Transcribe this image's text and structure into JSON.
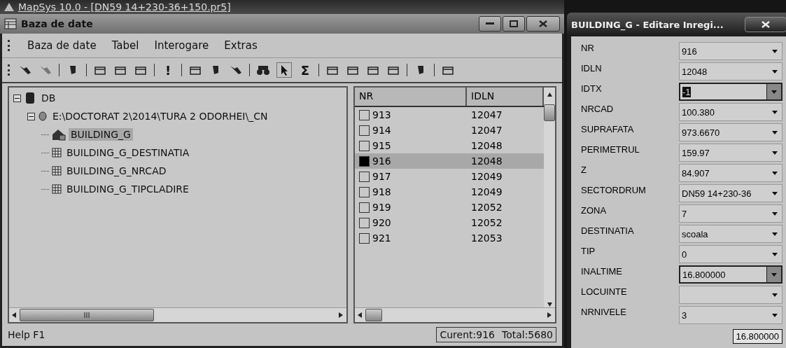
{
  "app_title": "MapSys 10.0 - [DN59 14+230-36+150.pr5]",
  "window": {
    "title": "Baza de date"
  },
  "menu": [
    {
      "label": "Baza de date"
    },
    {
      "label": "Tabel"
    },
    {
      "label": "Interogare"
    },
    {
      "label": "Extras"
    }
  ],
  "toolbar_glyphs": [
    "!",
    "Σ"
  ],
  "tree": [
    {
      "label": "DB",
      "kind": "database",
      "expanded": true,
      "selected": false,
      "children": [
        {
          "label": "E:\\DOCTORAT 2\\2014\\TURA 2 ODORHEI\\_CN",
          "kind": "file",
          "expanded": true,
          "selected": false,
          "children": [
            {
              "label": "BUILDING_G",
              "kind": "layer",
              "selected": true
            },
            {
              "label": "BUILDING_G_DESTINATIA",
              "kind": "table",
              "selected": false
            },
            {
              "label": "BUILDING_G_NRCAD",
              "kind": "table",
              "selected": false
            },
            {
              "label": "BUILDING_G_TIPCLADIRE",
              "kind": "table",
              "selected": false
            }
          ]
        }
      ]
    }
  ],
  "table": {
    "columns": [
      "NR",
      "IDLN"
    ],
    "rows": [
      {
        "cells": [
          "913",
          "12047"
        ],
        "selected": false
      },
      {
        "cells": [
          "914",
          "12047"
        ],
        "selected": false
      },
      {
        "cells": [
          "915",
          "12048"
        ],
        "selected": false
      },
      {
        "cells": [
          "916",
          "12048"
        ],
        "selected": true
      },
      {
        "cells": [
          "917",
          "12049"
        ],
        "selected": false
      },
      {
        "cells": [
          "918",
          "12049"
        ],
        "selected": false
      },
      {
        "cells": [
          "919",
          "12052"
        ],
        "selected": false
      },
      {
        "cells": [
          "920",
          "12052"
        ],
        "selected": false
      },
      {
        "cells": [
          "921",
          "12053"
        ],
        "selected": false
      }
    ]
  },
  "status_bar": {
    "help": "Help F1",
    "current": "Curent:916",
    "total": "Total:5680"
  },
  "dialog": {
    "title": "BUILDING_G - Editare Inregi...",
    "fields": [
      {
        "label": "NR",
        "value": "916",
        "active": false
      },
      {
        "label": "IDLN",
        "value": "12048",
        "active": false
      },
      {
        "label": "IDTX",
        "value": "-1",
        "active": true
      },
      {
        "label": "NRCAD",
        "value": "100.380",
        "active": false
      },
      {
        "label": "SUPRAFATA",
        "value": "973.6670",
        "active": false
      },
      {
        "label": "PERIMETRUL",
        "value": "159.97",
        "active": false
      },
      {
        "label": "Z",
        "value": "84.907",
        "active": false
      },
      {
        "label": "SECTORDRUM",
        "value": "DN59 14+230-36",
        "active": false
      },
      {
        "label": "ZONA",
        "value": "7",
        "active": false
      },
      {
        "label": "DESTINATIA",
        "value": "scoala",
        "active": false
      },
      {
        "label": "TIP",
        "value": "0",
        "active": false
      },
      {
        "label": "INALTIME",
        "value": "16.800000",
        "active": true
      },
      {
        "label": "LOCUINTE",
        "active": false
      },
      {
        "label": "NRNIVELE",
        "value": "3",
        "active": false
      }
    ],
    "tooltip": "16.800000"
  }
}
